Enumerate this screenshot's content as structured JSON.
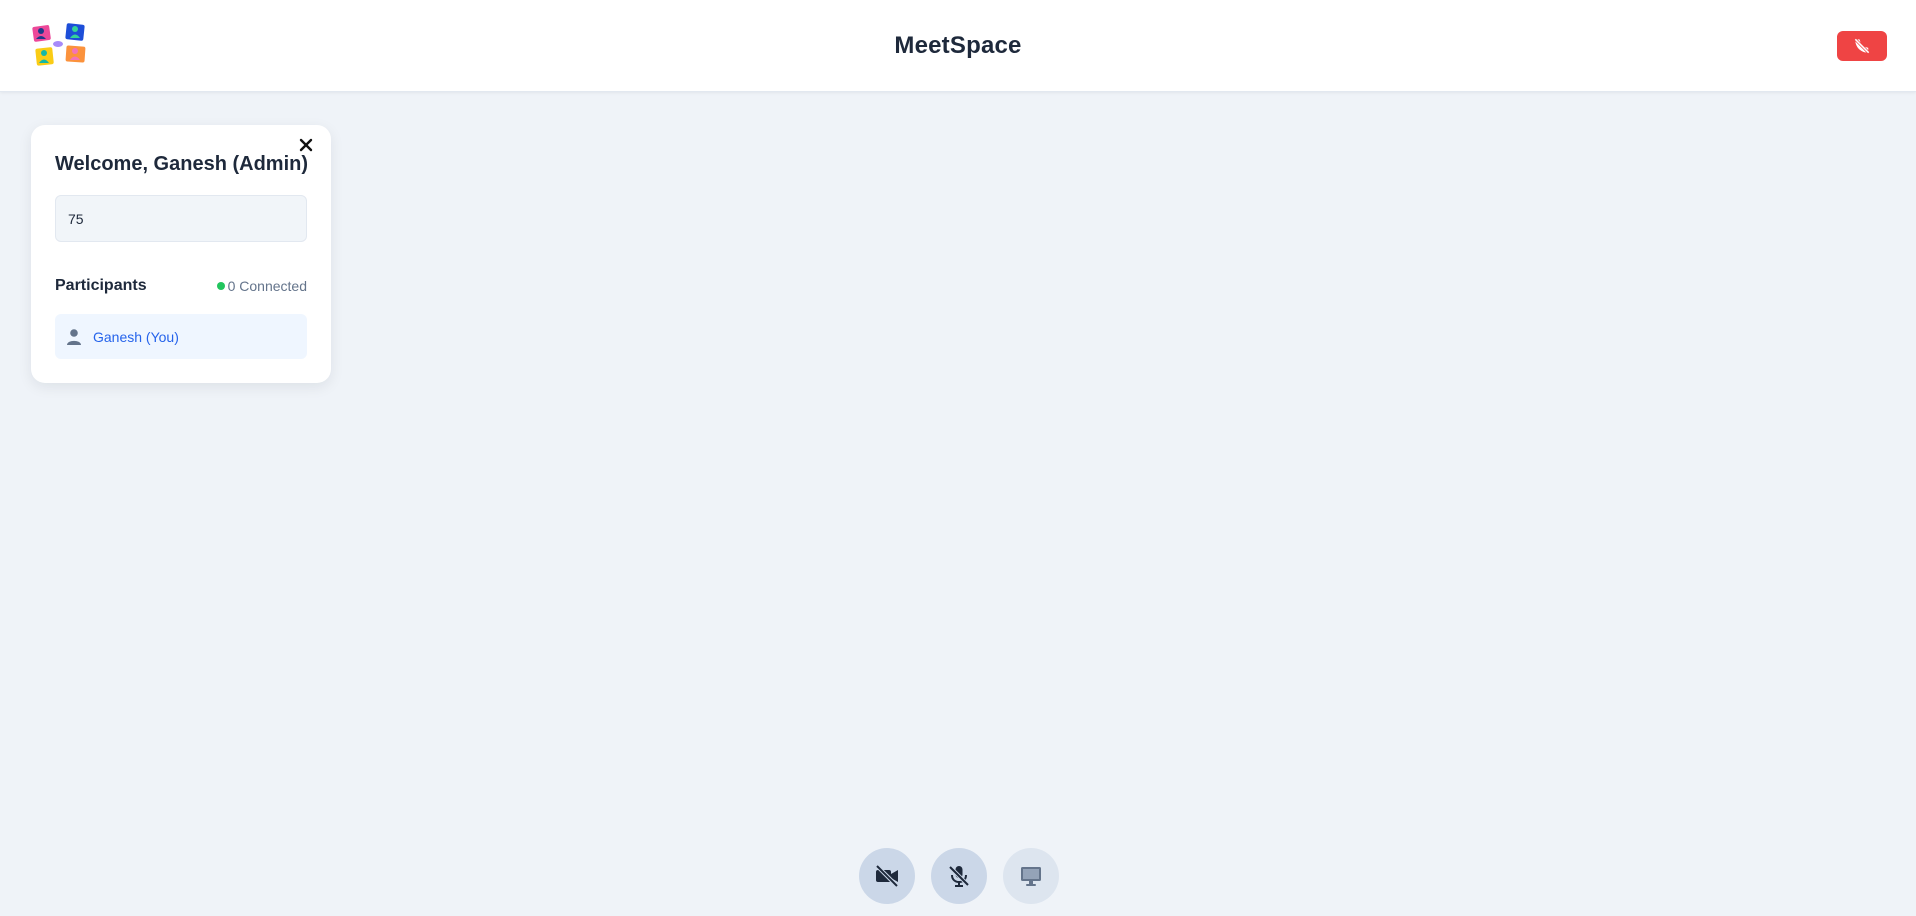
{
  "header": {
    "title": "MeetSpace",
    "logo_icon": "meetspace-logo-icon",
    "end_call_icon": "phone-end-icon",
    "end_call_color": "#ef4444"
  },
  "sidebar": {
    "welcome_text": "Welcome, Ganesh (Admin)",
    "meeting_input_value": "75",
    "participants_label": "Participants",
    "connected_text": "0 Connected",
    "connected_dot_color": "#22c55e",
    "participants": [
      {
        "name": "Ganesh (You)",
        "icon": "user-icon"
      }
    ]
  },
  "controls": [
    {
      "name": "camera",
      "icon": "video-off-icon"
    },
    {
      "name": "microphone",
      "icon": "mic-off-icon"
    },
    {
      "name": "screen-share",
      "icon": "monitor-icon"
    }
  ]
}
